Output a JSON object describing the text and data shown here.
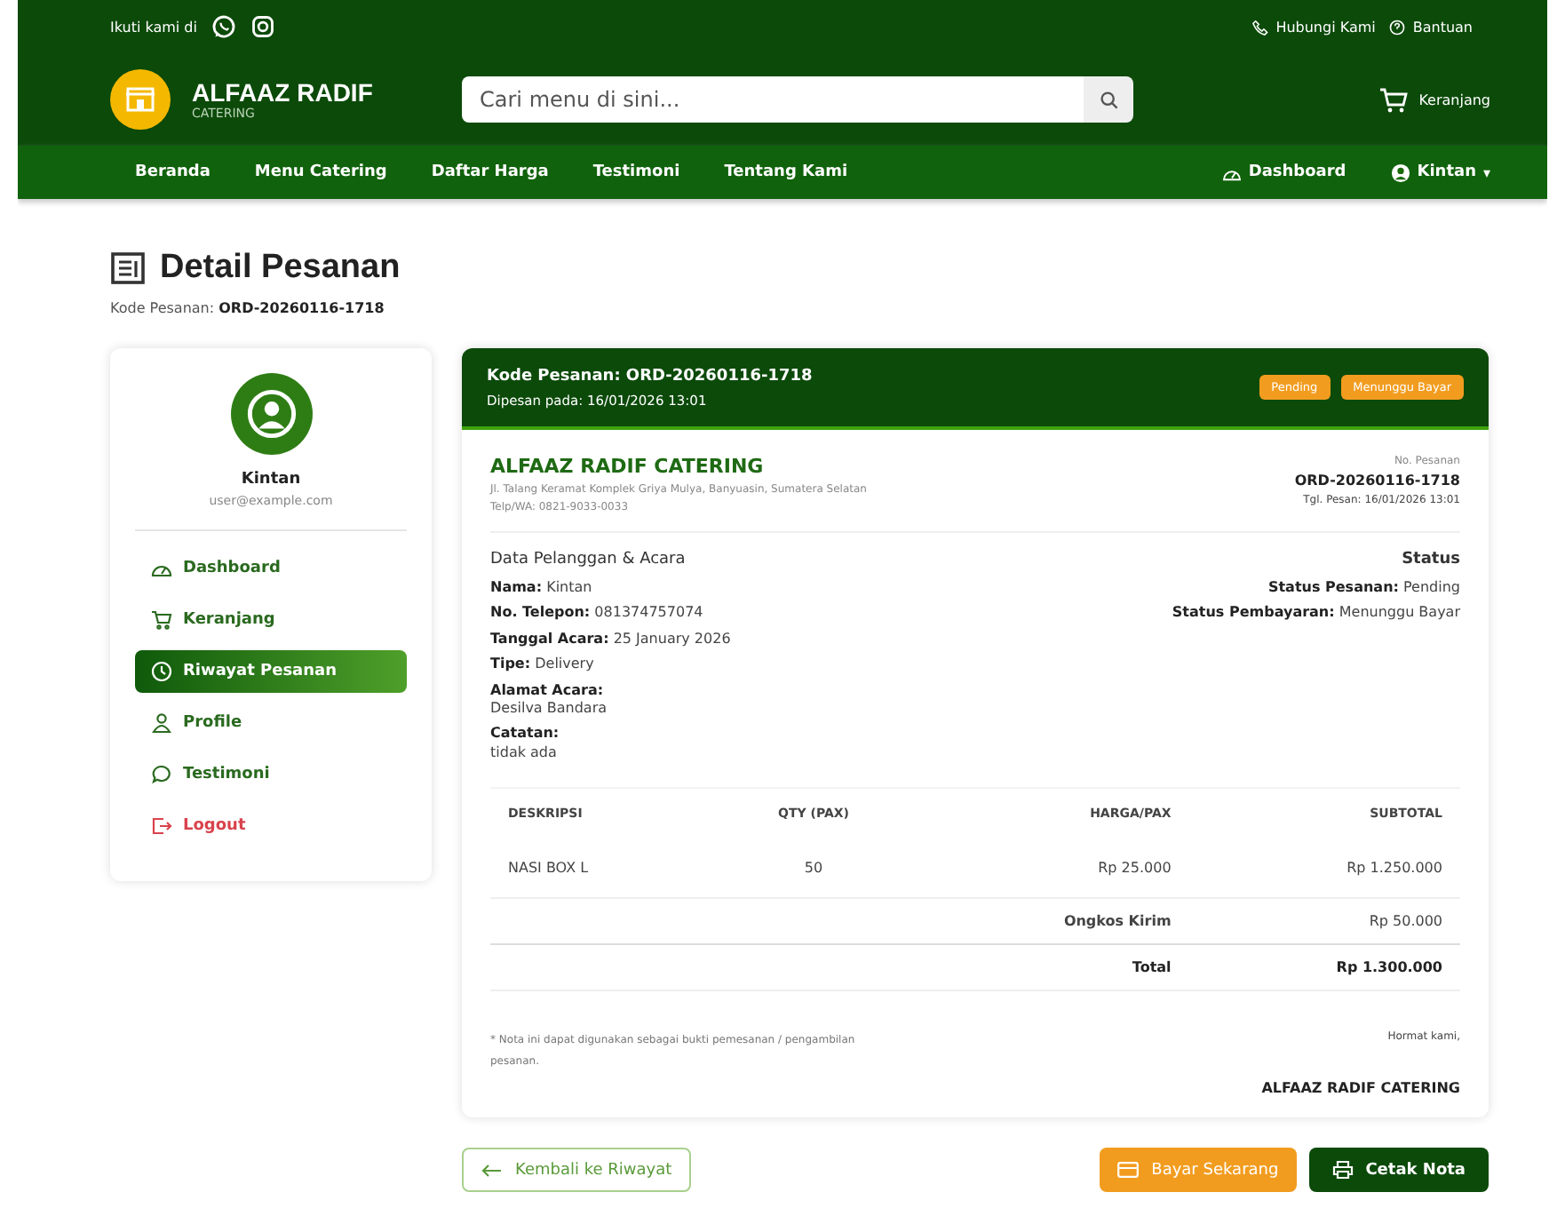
{
  "topbar": {
    "follow_label": "Ikuti kami di",
    "links": [
      "Hubungi Kami",
      "Bantuan"
    ]
  },
  "header": {
    "brand": "ALFAAZ RADIF",
    "brand_sub": "CATERING",
    "search": {
      "placeholder": "Cari menu di sini..."
    },
    "cart": "Keranjang"
  },
  "nav": {
    "items": [
      "Beranda",
      "Menu Catering",
      "Daftar Harga",
      "Testimoni",
      "Tentang Kami"
    ],
    "dashboard": "Dashboard",
    "user": "Kintan",
    "caret": "▾"
  },
  "page": {
    "title": "Detail Pesanan",
    "code_label": "Kode Pesanan:",
    "code": "ORD-20260116-1718"
  },
  "sidebar": {
    "name": "Kintan",
    "email": "user@example.com",
    "items": [
      {
        "label": "Dashboard",
        "kind": "dashboard",
        "selected": false
      },
      {
        "label": "Keranjang",
        "kind": "cart",
        "selected": false
      },
      {
        "label": "Riwayat Pesanan",
        "kind": "history",
        "selected": true
      },
      {
        "label": "Profile",
        "kind": "profile",
        "selected": false
      },
      {
        "label": "Testimoni",
        "kind": "testimonial",
        "selected": false
      },
      {
        "label": "Logout",
        "kind": "logout",
        "selected": false
      }
    ]
  },
  "order": {
    "code_line": "Kode Pesanan: ORD-20260116-1718",
    "date_line": "Dipesan pada: 16/01/2026 13:01",
    "badges": [
      "Pending",
      "Menunggu Bayar"
    ],
    "company": "ALFAAZ RADIF CATERING",
    "address": "Jl. Talang Keramat Komplek Griya Mulya, Banyuasin, Sumatera Selatan",
    "phone": "Telp/WA: 0821-9033-0033",
    "no_label": "No. Pesanan",
    "no": "ORD-20260116-1718",
    "date": "Tgl. Pesan: 16/01/2026 13:01",
    "customer_title": "Data Pelanggan & Acara",
    "customer": [
      {
        "label": "Nama:",
        "value": "Kintan",
        "kind": "inline"
      },
      {
        "label": "No. Telepon:",
        "value": "081374757074",
        "kind": "inline"
      },
      {
        "label": "Tanggal Acara:",
        "value": "25 January 2026",
        "kind": "inline"
      },
      {
        "label": "Tipe:",
        "value": "Delivery",
        "kind": "inline"
      },
      {
        "label": "Alamat Acara:",
        "value": "Desilva Bandara",
        "kind": "block"
      },
      {
        "label": "Catatan:",
        "value": "tidak ada",
        "kind": "block"
      }
    ],
    "status_title": "Status",
    "status": [
      {
        "label": "Status Pesanan:",
        "value": "Pending"
      },
      {
        "label": "Status Pembayaran:",
        "value": "Menunggu Bayar"
      }
    ],
    "table": {
      "columns": [
        "DESKRIPSI",
        "QTY (PAX)",
        "HARGA/PAX",
        "SUBTOTAL"
      ],
      "rows": [
        [
          "NASI BOX L",
          "50",
          "Rp 25.000",
          "Rp 1.250.000"
        ]
      ],
      "shipping_label": "Ongkos Kirim",
      "shipping": "Rp 50.000",
      "total_label": "Total",
      "total": "Rp 1.300.000"
    },
    "note": "* Nota ini dapat digunakan sebagai bukti pemesanan / pengambilan pesanan.",
    "regards": "Hormat kami,",
    "signature": "ALFAAZ RADIF CATERING"
  },
  "actions": {
    "back": "Kembali ke Riwayat",
    "pay": "Bayar Sekarang",
    "print": "Cetak Nota"
  }
}
